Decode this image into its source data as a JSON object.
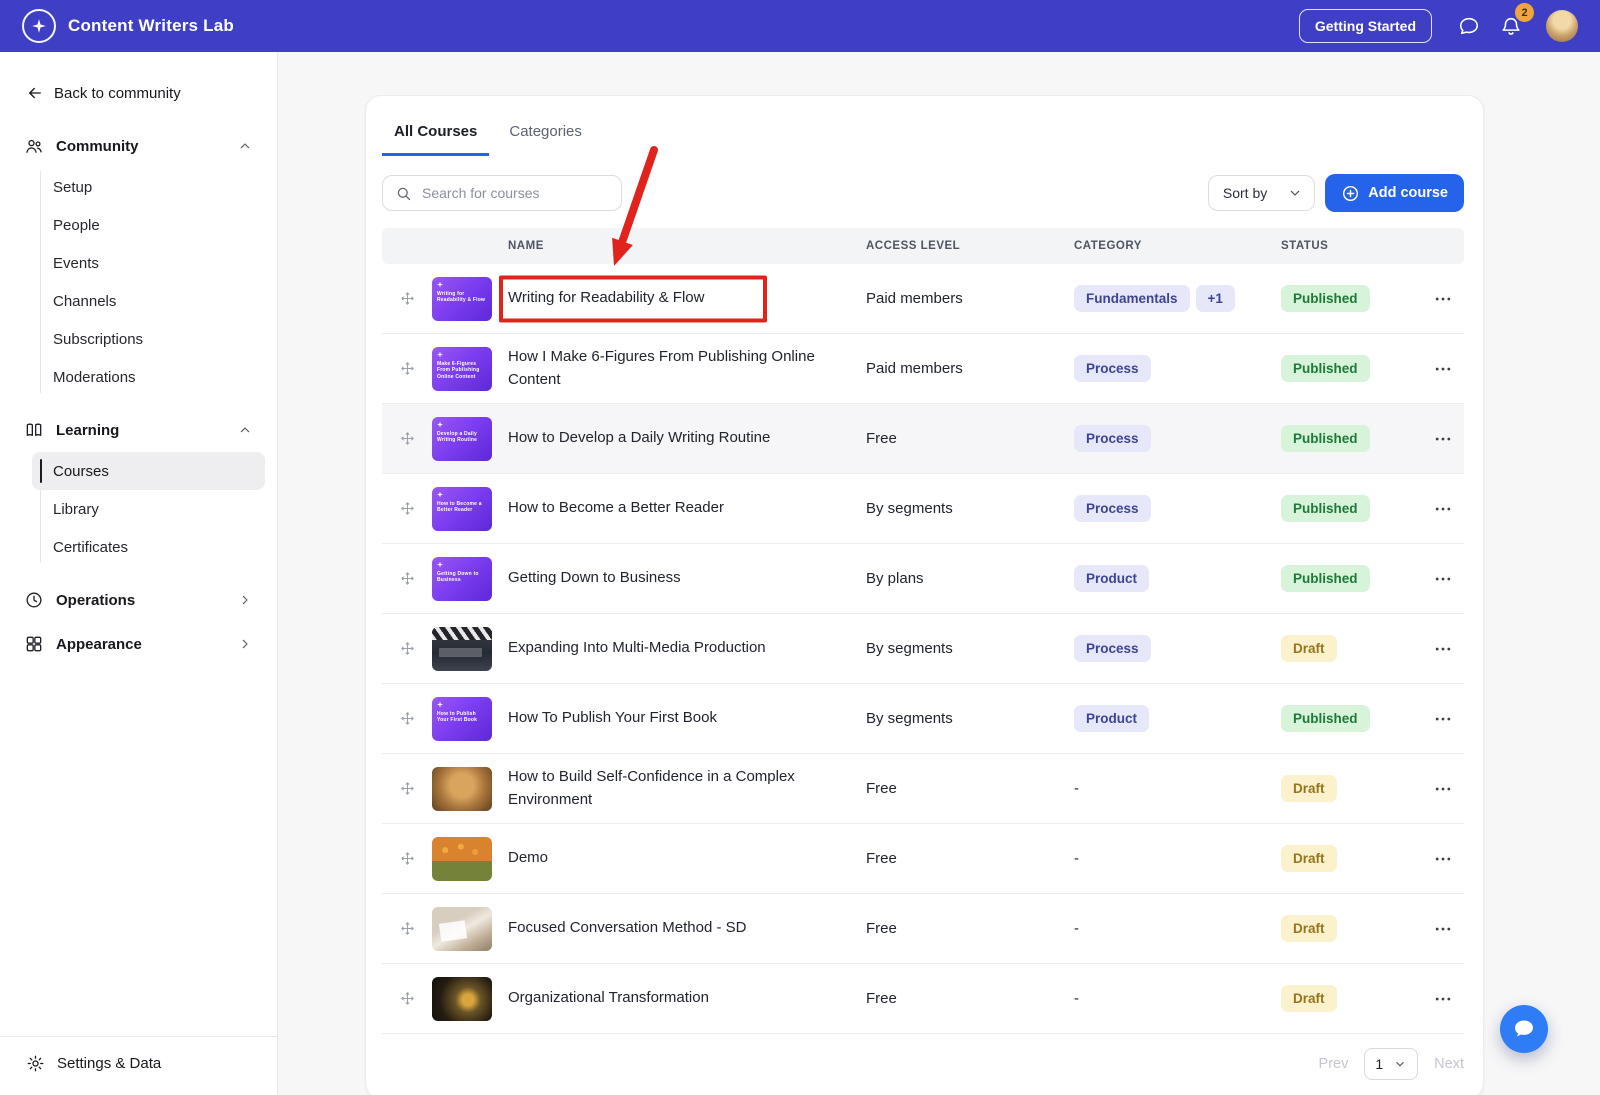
{
  "topbar": {
    "brand": "Content Writers Lab",
    "getting_started_label": "Getting Started",
    "notification_count": "2"
  },
  "sidebar": {
    "back_label": "Back to community",
    "sections": [
      {
        "label": "Community",
        "icon": "community-icon",
        "state": "expanded",
        "items": [
          {
            "label": "Setup"
          },
          {
            "label": "People"
          },
          {
            "label": "Events"
          },
          {
            "label": "Channels"
          },
          {
            "label": "Subscriptions"
          },
          {
            "label": "Moderations"
          }
        ]
      },
      {
        "label": "Learning",
        "icon": "learning-icon",
        "state": "expanded",
        "items": [
          {
            "label": "Courses",
            "selected": true
          },
          {
            "label": "Library"
          },
          {
            "label": "Certificates"
          }
        ]
      },
      {
        "label": "Operations",
        "icon": "operations-icon",
        "state": "collapsed",
        "items": []
      },
      {
        "label": "Appearance",
        "icon": "appearance-icon",
        "state": "collapsed",
        "items": []
      }
    ],
    "footer_label": "Settings & Data"
  },
  "main": {
    "tabs": [
      {
        "label": "All Courses",
        "active": true
      },
      {
        "label": "Categories",
        "active": false
      }
    ],
    "search_placeholder": "Search for courses",
    "sort_by_label": "Sort by",
    "add_course_label": "Add course",
    "table": {
      "headers": [
        "NAME",
        "ACCESS LEVEL",
        "CATEGORY",
        "STATUS"
      ],
      "rows": [
        {
          "name": "Writing for Readability & Flow",
          "access_level": "Paid members",
          "categories": [
            "Fundamentals",
            "+1"
          ],
          "status": "Published",
          "thumbnail": "purple-gradient",
          "thumb_label": "Writing for Readability & Flow",
          "annotated": true
        },
        {
          "name": "How I Make 6-Figures From Publishing Online Content",
          "access_level": "Paid members",
          "categories": [
            "Process"
          ],
          "status": "Published",
          "thumbnail": "purple-gradient",
          "thumb_label": "Make 6-Figures From Publishing Online Content"
        },
        {
          "name": "How to Develop a Daily Writing Routine",
          "access_level": "Free",
          "categories": [
            "Process"
          ],
          "status": "Published",
          "thumbnail": "purple-gradient",
          "thumb_label": "Develop a Daily Writing Routine",
          "highlighted": true
        },
        {
          "name": "How to Become a Better Reader",
          "access_level": "By segments",
          "categories": [
            "Process"
          ],
          "status": "Published",
          "thumbnail": "purple-gradient",
          "thumb_label": "How to Become a Better Reader"
        },
        {
          "name": "Getting Down to Business",
          "access_level": "By plans",
          "categories": [
            "Product"
          ],
          "status": "Published",
          "thumbnail": "purple-gradient",
          "thumb_label": "Getting Down to Business"
        },
        {
          "name": "Expanding Into Multi-Media Production",
          "access_level": "By segments",
          "categories": [
            "Process"
          ],
          "status": "Draft",
          "thumbnail": "clapperboard-photo"
        },
        {
          "name": "How To Publish Your First Book",
          "access_level": "By segments",
          "categories": [
            "Product"
          ],
          "status": "Published",
          "thumbnail": "purple-gradient",
          "thumb_label": "How to Publish Your First Book"
        },
        {
          "name": "How to Build Self-Confidence in a Complex Environment",
          "access_level": "Free",
          "categories": [
            "-"
          ],
          "status": "Draft",
          "thumbnail": "lion-photo"
        },
        {
          "name": "Demo",
          "access_level": "Free",
          "categories": [
            "-"
          ],
          "status": "Draft",
          "thumbnail": "flowers-photo"
        },
        {
          "name": "Focused Conversation Method - SD",
          "access_level": "Free",
          "categories": [
            "-"
          ],
          "status": "Draft",
          "thumbnail": "desk-photo"
        },
        {
          "name": "Organizational Transformation",
          "access_level": "Free",
          "categories": [
            "-"
          ],
          "status": "Draft",
          "thumbnail": "gavel-photo"
        }
      ]
    },
    "pagination": {
      "prev_label": "Prev",
      "page": "1",
      "next_label": "Next"
    }
  },
  "annotation": {
    "type": "red-box-and-arrow",
    "target": "Writing for Readability & Flow"
  },
  "colors": {
    "topbar_bg": "#3F3FC6",
    "accent_blue": "#2563EB",
    "category_chip_bg": "#E6E8FA",
    "category_chip_text": "#3D4496",
    "published_bg": "#D7F3DA",
    "published_text": "#1D7A37",
    "draft_bg": "#FCF1CD",
    "draft_text": "#95751C",
    "notification_badge_bg": "#F0A63C",
    "annotation_red": "#E0231D",
    "chat_fab_bg": "#2E7CF6"
  }
}
